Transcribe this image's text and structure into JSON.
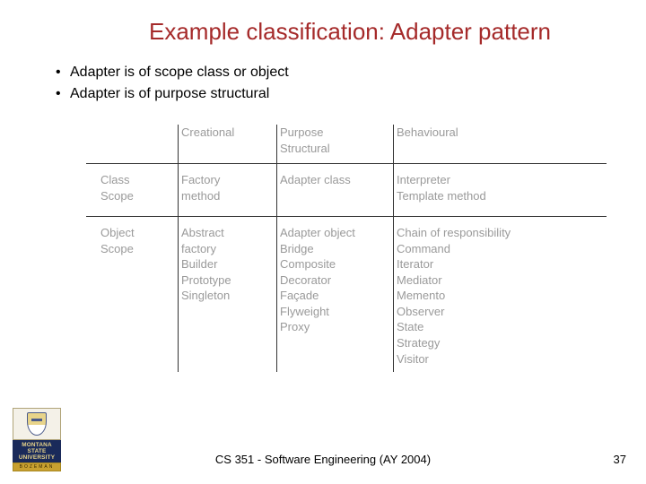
{
  "title": "Example classification: Adapter pattern",
  "bullets": [
    "Adapter is of scope class or object",
    "Adapter is of purpose structural"
  ],
  "table": {
    "purpose_label": "Purpose",
    "headers": {
      "c1": "",
      "c2": "Creational",
      "c3": "Structural",
      "c4": "Behavioural"
    },
    "row_class": {
      "label": "Class\nScope",
      "creational": "Factory\nmethod",
      "structural": "Adapter class",
      "behavioural": "Interpreter\nTemplate method"
    },
    "row_object": {
      "label": "Object\nScope",
      "creational": "Abstract\nfactory\nBuilder\nPrototype\nSingleton",
      "structural": "Adapter object\nBridge\nComposite\nDecorator\nFaçade\nFlyweight\nProxy",
      "behavioural": "Chain of responsibility\nCommand\nIterator\nMediator\nMemento\nObserver\nState\nStrategy\nVisitor"
    }
  },
  "logo": {
    "line1": "MONTANA",
    "line2": "STATE UNIVERSITY",
    "bottom": "BOZEMAN"
  },
  "footer": "CS 351 - Software Engineering (AY 2004)",
  "page": "37"
}
